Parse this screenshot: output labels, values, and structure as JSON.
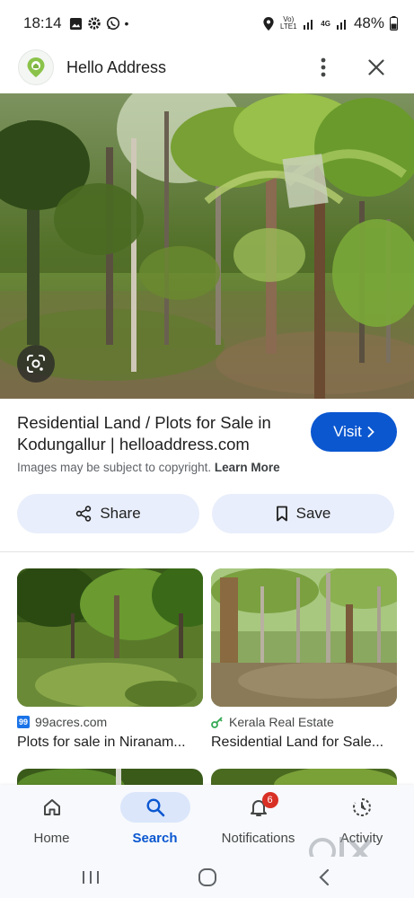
{
  "status_bar": {
    "time": "18:14",
    "dot": "•",
    "network": "Vo) LTE1",
    "network2": "4G",
    "battery": "48%"
  },
  "header": {
    "title": "Hello Address"
  },
  "result": {
    "title": "Residential Land / Plots for Sale in Kodungallur | helloaddress.com",
    "visit_label": "Visit",
    "copyright_text": "Images may be subject to copyright.",
    "learn_more": "Learn More",
    "share_label": "Share",
    "save_label": "Save"
  },
  "related": [
    {
      "source": "99acres.com",
      "badge": "99",
      "title": "Plots for sale in Niranam..."
    },
    {
      "source": "Kerala Real Estate",
      "title": "Residential Land for Sale..."
    }
  ],
  "bottom_nav": {
    "items": [
      {
        "label": "Home",
        "icon": "home-icon"
      },
      {
        "label": "Search",
        "icon": "search-icon",
        "active": true
      },
      {
        "label": "Notifications",
        "icon": "bell-icon",
        "badge": "6"
      },
      {
        "label": "Activity",
        "icon": "activity-icon"
      }
    ]
  },
  "colors": {
    "accent": "#0b57d0",
    "pill_bg": "#e8eefb",
    "badge_red": "#d93025"
  }
}
